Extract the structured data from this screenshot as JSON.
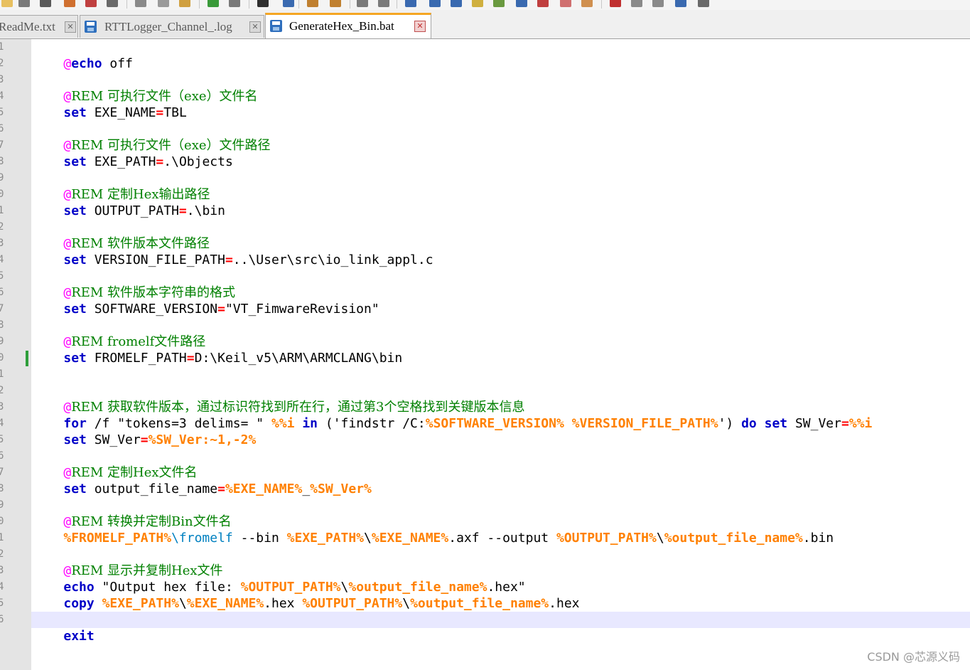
{
  "tabs": [
    {
      "label": "ReadMe.txt",
      "close": "✕",
      "active": false
    },
    {
      "label": "RTTLogger_Channel_.log",
      "close": "✕",
      "active": false
    },
    {
      "label": "GenerateHex_Bin.bat",
      "close": "✕",
      "active": true
    }
  ],
  "toolbar_icons": [
    "new-file-icon",
    "save-icon",
    "save-all-icon",
    "close-icon",
    "close-all-icon",
    "print-icon",
    "cut-icon",
    "copy-icon",
    "paste-icon",
    "undo-icon",
    "redo-icon",
    "find-icon",
    "replace-icon",
    "zoom-in-icon",
    "zoom-out-icon",
    "sync-scroll-icon",
    "word-wrap-icon",
    "indent-guide-icon",
    "fold-icon",
    "macro-record-icon",
    "macro-play-icon"
  ],
  "colors": {
    "keyword": "#0000c8",
    "comment": "#008000",
    "variable": "#ff8000",
    "operator": "#ff0000",
    "at_sign": "#ff00ff",
    "active_tab_accent": "#f5a623",
    "current_line": "#e8e8ff"
  },
  "code": {
    "l1": {
      "at": "@",
      "kw": "echo",
      "rest": " off"
    },
    "l3": {
      "at": "@",
      "text": "REM 可执行文件（exe）文件名"
    },
    "l4": {
      "kw": "set",
      "name": " EXE_NAME",
      "op": "=",
      "val": "TBL"
    },
    "l6": {
      "at": "@",
      "text": "REM 可执行文件（exe）文件路径"
    },
    "l7": {
      "kw": "set",
      "name": " EXE_PATH",
      "op": "=",
      "val": ".\\Objects"
    },
    "l9": {
      "at": "@",
      "text": "REM 定制Hex输出路径"
    },
    "l10": {
      "kw": "set",
      "name": " OUTPUT_PATH",
      "op": "=",
      "val": ".\\bin"
    },
    "l12": {
      "at": "@",
      "text": "REM 软件版本文件路径"
    },
    "l13": {
      "kw": "set",
      "name": " VERSION_FILE_PATH",
      "op": "=",
      "val": "..\\User\\src\\io_link_appl.c"
    },
    "l15": {
      "at": "@",
      "text": "REM 软件版本字符串的格式"
    },
    "l16": {
      "kw": "set",
      "name": " SOFTWARE_VERSION",
      "op": "=",
      "val": "\"VT_FimwareRevision\""
    },
    "l18": {
      "at": "@",
      "text": "REM fromelf文件路径"
    },
    "l19": {
      "kw": "set",
      "name": " FROMELF_PATH",
      "op": "=",
      "val": "D:\\Keil_v5\\ARM\\ARMCLANG\\bin"
    },
    "l22": {
      "at": "@",
      "text": "REM 获取软件版本，通过标识符找到所在行，通过第3个空格找到关键版本信息"
    },
    "l23": {
      "kw_for": "for",
      "t1": " /f \"tokens=3 delims= \" ",
      "var_i": "%%i",
      "sp1": " ",
      "kw_in": "in",
      "t2": " ('findstr /C:",
      "var_sv": "%SOFTWARE_VERSION%",
      "sp2": " ",
      "var_vfp": "%VERSION_FILE_PATH%",
      "t3": "') ",
      "kw_do": "do",
      "sp3": " ",
      "kw_set": "set",
      "t4": " SW_Ver",
      "op": "=",
      "var_i2": "%%i"
    },
    "l24": {
      "kw": "set",
      "name": " SW_Ver",
      "op": "=",
      "var": "%SW_Ver:~1,-2%"
    },
    "l26": {
      "at": "@",
      "text": "REM 定制Hex文件名"
    },
    "l27": {
      "kw": "set",
      "name": " output_file_name",
      "op": "=",
      "var1": "%EXE_NAME%",
      "sep": "_",
      "var2": "%SW_Ver%"
    },
    "l29": {
      "at": "@",
      "text": "REM 转换并定制Bin文件名"
    },
    "l30": {
      "var1": "%FROMELF_PATH%",
      "fromelf": "\\fromelf",
      "t1": " --bin ",
      "var2": "%EXE_PATH%",
      "s1": "\\",
      "var3": "%EXE_NAME%",
      "t2": ".axf --output ",
      "var4": "%OUTPUT_PATH%",
      "s2": "\\",
      "var5": "%output_file_name%",
      "t3": ".bin"
    },
    "l32": {
      "at": "@",
      "text": "REM 显示并复制Hex文件"
    },
    "l33": {
      "kw": "echo",
      "t1": " \"Output hex file: ",
      "var1": "%OUTPUT_PATH%",
      "s1": "\\",
      "var2": "%output_file_name%",
      "t2": ".hex\""
    },
    "l34": {
      "kw": "copy",
      "t1": " ",
      "var1": "%EXE_PATH%",
      "s1": "\\",
      "var2": "%EXE_NAME%",
      "t2": ".hex ",
      "var3": "%OUTPUT_PATH%",
      "s2": "\\",
      "var4": "%output_file_name%",
      "t3": ".hex"
    },
    "l36": {
      "kw": "exit"
    }
  },
  "line_numbers": [
    "1",
    "2",
    "3",
    "4",
    "5",
    "6",
    "7",
    "8",
    "9",
    "0",
    "1",
    "2",
    "3",
    "4",
    "5",
    "6",
    "7",
    "8",
    "9",
    "0",
    "1",
    "2",
    "3",
    "4",
    "5",
    "6",
    "7",
    "8",
    "9",
    "0",
    "1",
    "2",
    "3",
    "4",
    "5",
    "6"
  ],
  "watermark": "CSDN @芯源义码"
}
